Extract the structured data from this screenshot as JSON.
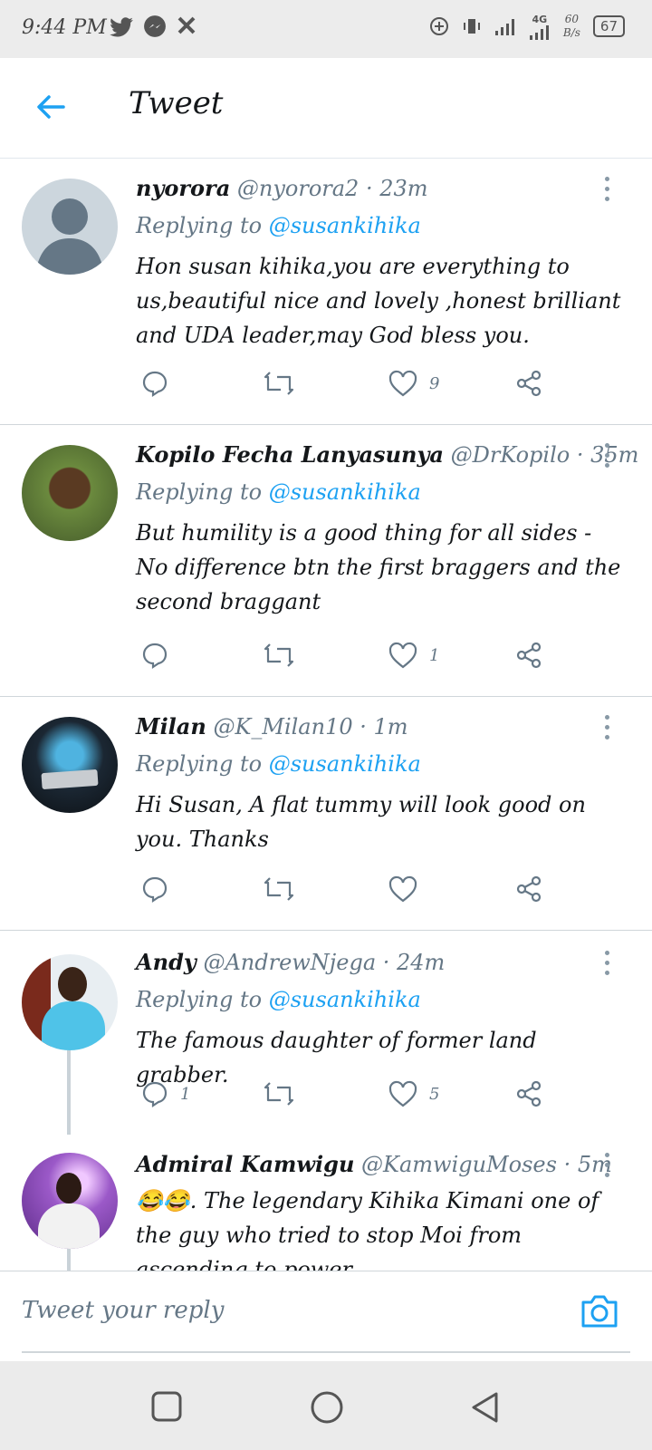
{
  "status_bar": {
    "time": "9:44 PM",
    "network": "4G",
    "speed_value": "60",
    "speed_unit": "B/s",
    "battery": "67",
    "app_icons": [
      "twitter-icon",
      "messenger-icon",
      "x-icon"
    ]
  },
  "header": {
    "title": "Tweet"
  },
  "tweets": [
    {
      "name": "nyorora",
      "handle": "@nyorora2 · 23m",
      "replying_label": "Replying to",
      "replying_to": "@susankihika",
      "text": "Hon susan kihika,you are everything to us,beautiful nice and lovely ,honest brilliant and UDA leader,may God bless you.",
      "replies": "",
      "likes": "9"
    },
    {
      "name": "Kopilo Fecha Lanyasunya",
      "handle": "@DrKopilo · 35m",
      "replying_label": "Replying to",
      "replying_to": "@susankihika",
      "text": "But humility is a good thing for all sides - No difference btn the first braggers and the second braggant",
      "replies": "",
      "likes": "1"
    },
    {
      "name": "Milan",
      "handle": "@K_Milan10 · 1m",
      "replying_label": "Replying to",
      "replying_to": "@susankihika",
      "text": "Hi Susan, A flat tummy will look good on you. Thanks",
      "replies": "",
      "likes": ""
    },
    {
      "name": "Andy",
      "handle": "@AndrewNjega · 24m",
      "replying_label": "Replying to",
      "replying_to": "@susankihika",
      "text": "The famous daughter of former land grabber.",
      "replies": "1",
      "likes": "5"
    },
    {
      "name": "Admiral Kamwigu",
      "handle": "@KamwiguMoses · 5m",
      "text": "😂😂. The legendary Kihika Kimani one of the guy who tried to stop Moi from ascending to power."
    }
  ],
  "reply_bar": {
    "placeholder": "Tweet your reply"
  },
  "colors": {
    "accent": "#1da1f2",
    "text": "#14171a",
    "muted": "#657786",
    "divider": "#d0d6da"
  }
}
